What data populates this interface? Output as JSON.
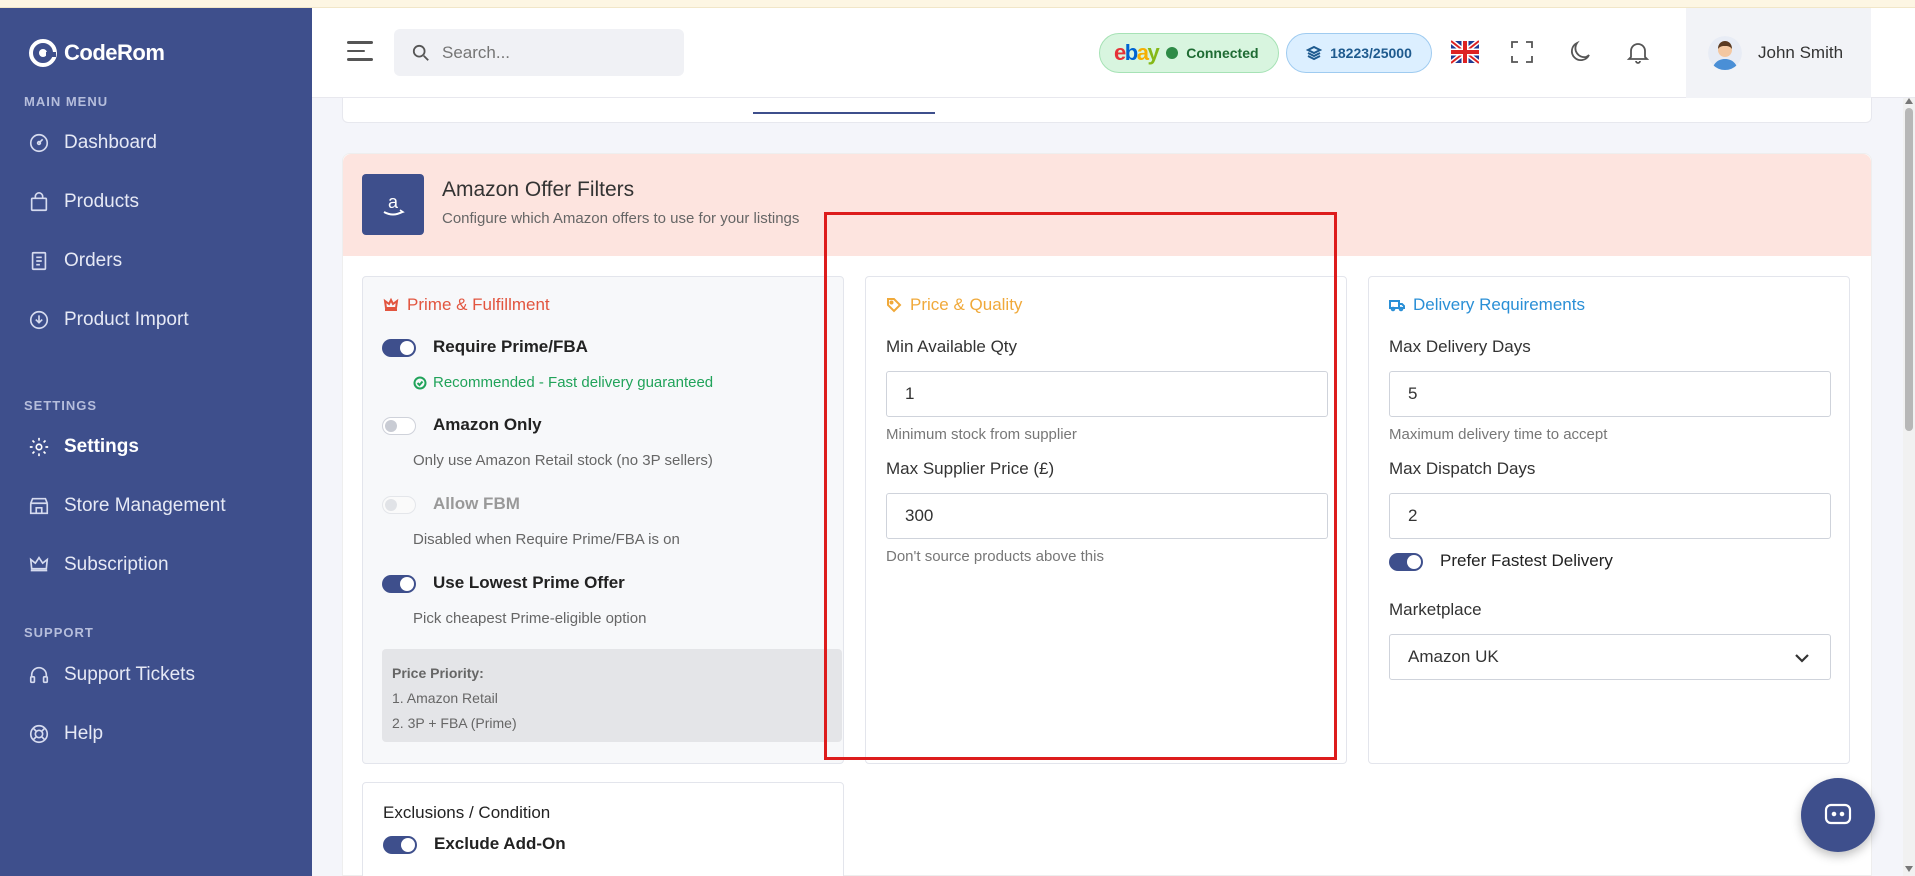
{
  "brand": {
    "name": "CodeRom"
  },
  "sidebar": {
    "sections": {
      "main": "MAIN MENU",
      "settings": "SETTINGS",
      "support": "SUPPORT"
    },
    "items": [
      {
        "label": "Dashboard",
        "icon": "dashboard-icon"
      },
      {
        "label": "Products",
        "icon": "bag-icon"
      },
      {
        "label": "Orders",
        "icon": "orders-icon"
      },
      {
        "label": "Product Import",
        "icon": "import-icon"
      },
      {
        "label": "Settings",
        "icon": "gear-icon",
        "active": true
      },
      {
        "label": "Store Management",
        "icon": "store-icon"
      },
      {
        "label": "Subscription",
        "icon": "crown-icon"
      },
      {
        "label": "Support Tickets",
        "icon": "headset-icon"
      },
      {
        "label": "Help",
        "icon": "lifebuoy-icon"
      }
    ]
  },
  "header": {
    "search_placeholder": "Search...",
    "ebay_status": "Connected",
    "credits": "18223/25000",
    "user_name": "John Smith"
  },
  "panel": {
    "title": "Amazon Offer Filters",
    "subtitle": "Configure which Amazon offers to use for your listings"
  },
  "prime": {
    "title": "Prime & Fulfillment",
    "require_prime": {
      "label": "Require Prime/FBA",
      "on": true,
      "note": "Recommended - Fast delivery guaranteed"
    },
    "amazon_only": {
      "label": "Amazon Only",
      "on": false,
      "hint": "Only use Amazon Retail stock (no 3P sellers)"
    },
    "allow_fbm": {
      "label": "Allow FBM",
      "on": false,
      "disabled": true,
      "hint": "Disabled when Require Prime/FBA is on"
    },
    "lowest_prime": {
      "label": "Use Lowest Prime Offer",
      "on": true,
      "hint": "Pick cheapest Prime-eligible option"
    },
    "priority": {
      "title": "Price Priority:",
      "items": [
        "1. Amazon Retail",
        "2. 3P + FBA (Prime)"
      ]
    }
  },
  "price_quality": {
    "title": "Price & Quality",
    "min_qty": {
      "label": "Min Available Qty",
      "value": "1",
      "hint": "Minimum stock from supplier"
    },
    "max_price": {
      "label": "Max Supplier Price (£)",
      "value": "300",
      "hint": "Don't source products above this"
    }
  },
  "delivery": {
    "title": "Delivery Requirements",
    "max_delivery": {
      "label": "Max Delivery Days",
      "value": "5",
      "hint": "Maximum delivery time to accept"
    },
    "max_dispatch": {
      "label": "Max Dispatch Days",
      "value": "2"
    },
    "prefer_fastest": {
      "label": "Prefer Fastest Delivery",
      "on": true
    },
    "marketplace": {
      "label": "Marketplace",
      "value": "Amazon UK"
    }
  },
  "exclusions": {
    "title": "Exclusions / Condition",
    "exclude_addon": {
      "label": "Exclude Add-On",
      "on": true
    }
  },
  "colors": {
    "sidebar": "#3e4f8c",
    "prime_accent": "#e2553f",
    "price_accent": "#f0a93a",
    "delivery_accent": "#2a8fd6",
    "highlight": "#dd1c1c"
  }
}
